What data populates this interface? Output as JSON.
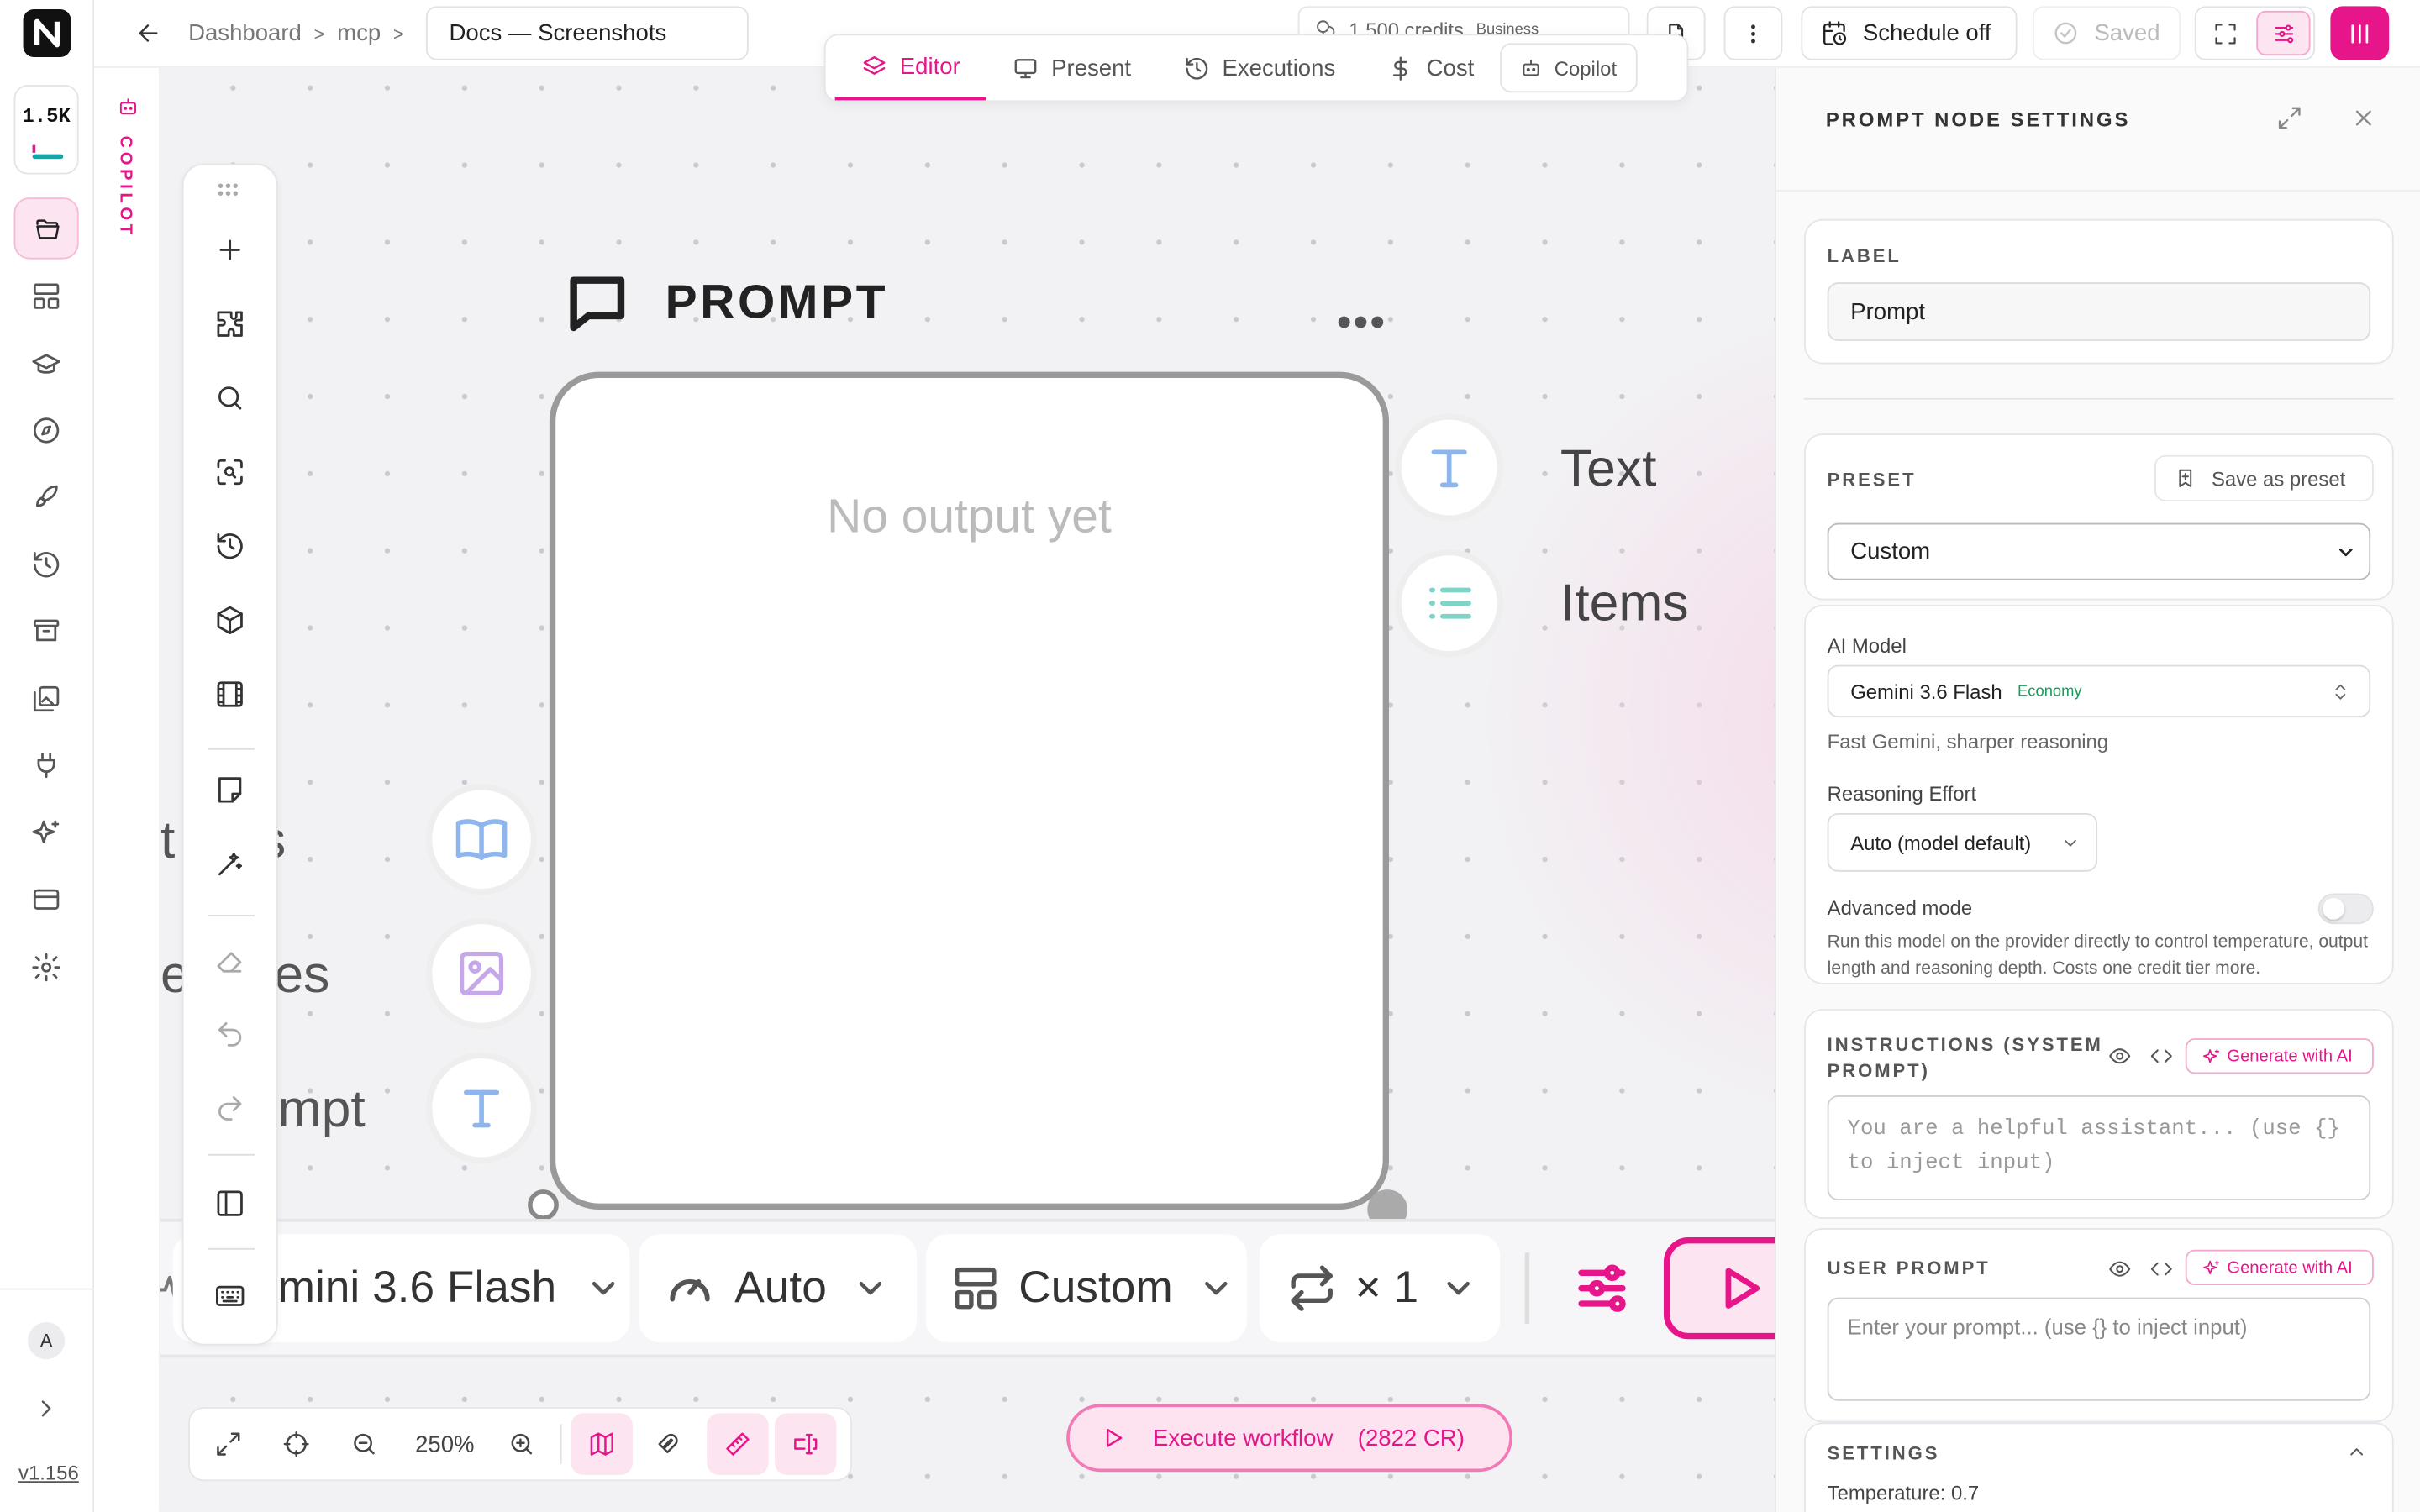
{
  "app": {
    "credits_badge": "1.5K",
    "version": "v1.156",
    "avatar": "A",
    "copilot_vertical": "COPILOT"
  },
  "breadcrumb": {
    "items": [
      "Dashboard",
      "mcp"
    ],
    "separator": ">"
  },
  "doc_title": "Docs — Screenshots",
  "credits_chip": {
    "text": "1 500 credits",
    "plan": "Business"
  },
  "toolbar": {
    "schedule": "Schedule off",
    "saved": "Saved"
  },
  "tabs": [
    {
      "label": "Editor",
      "active": true
    },
    {
      "label": "Present"
    },
    {
      "label": "Executions"
    },
    {
      "label": "Cost"
    },
    {
      "label": "Copilot"
    }
  ],
  "node": {
    "title": "PROMPT",
    "empty": "No output yet",
    "outputs": [
      "Text",
      "Items"
    ],
    "inputs": [
      "t ions",
      "ef nces",
      "mpt"
    ]
  },
  "node_bar": {
    "model": "mini 3.6 Flash",
    "effort": "Auto",
    "preset": "Custom",
    "repeat": "× 1"
  },
  "zoom": {
    "level": "250%"
  },
  "execute": {
    "label": "Execute workflow",
    "cost": "(2822 CR)"
  },
  "panel": {
    "title": "PROMPT NODE SETTINGS",
    "label_caption": "LABEL",
    "label_value": "Prompt",
    "preset_caption": "PRESET",
    "save_preset": "Save as preset",
    "preset_value": "Custom",
    "model_caption": "AI Model",
    "model_value": "Gemini 3.6 Flash",
    "model_tier": "Economy",
    "model_desc": "Fast Gemini, sharper reasoning",
    "effort_caption": "Reasoning Effort",
    "effort_value": "Auto (model default)",
    "advanced_caption": "Advanced mode",
    "advanced_desc": "Run this model on the provider directly to control temperature, output length and reasoning depth. Costs one credit tier more.",
    "instructions_caption": "INSTRUCTIONS (SYSTEM PROMPT)",
    "generate": "Generate with AI",
    "instructions_placeholder": "You are a helpful assistant... (use {} to inject input)",
    "user_caption": "USER PROMPT",
    "user_placeholder": "Enter your prompt... (use {} to inject input)",
    "settings_caption": "SETTINGS",
    "temperature": "Temperature: 0.7"
  },
  "colors": {
    "accent": "#e6168a",
    "accent_soft": "#fce4f0"
  }
}
